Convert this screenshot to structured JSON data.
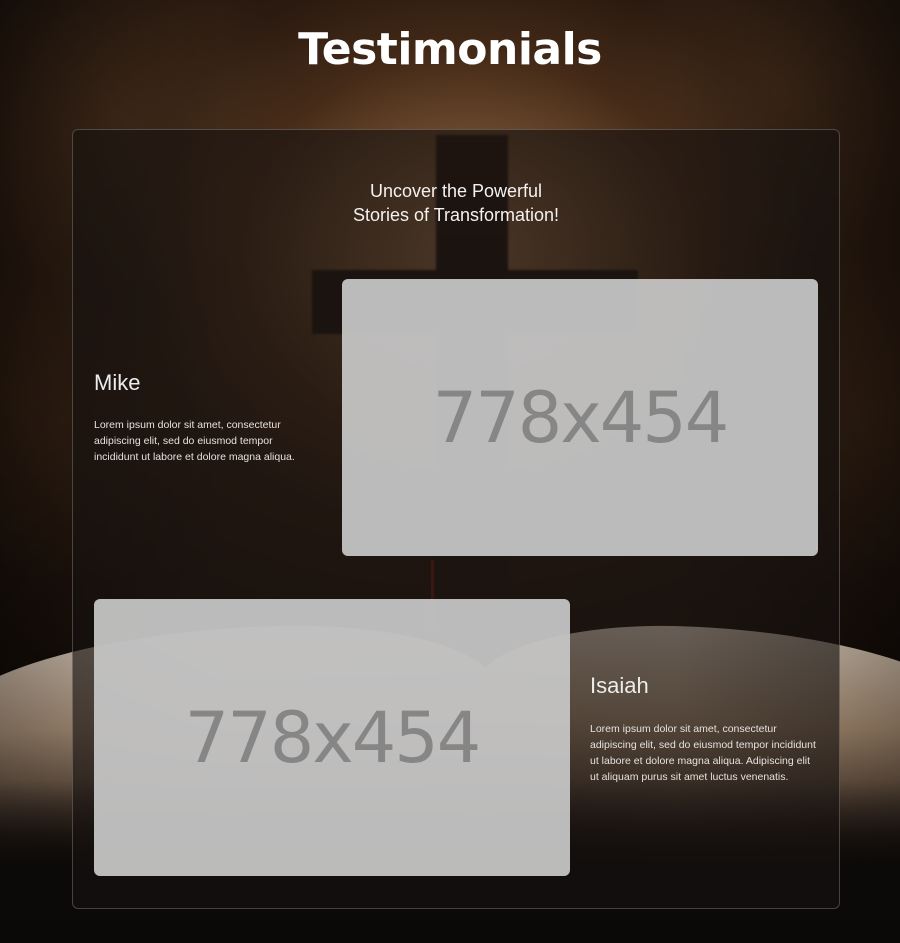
{
  "page": {
    "title": "Testimonials",
    "tagline_line1": "Uncover the Powerful",
    "tagline_line2": "Stories of Transformation!"
  },
  "testimonials": [
    {
      "name": "Mike",
      "text": "Lorem ipsum dolor sit amet, consectetur adipiscing elit, sed do eiusmod tempor incididunt ut labore et dolore magna aliqua.",
      "image_placeholder": "778x454"
    },
    {
      "name": "Isaiah",
      "text": "Lorem ipsum dolor sit amet, consectetur adipiscing elit, sed do eiusmod tempor incididunt ut labore et dolore magna aliqua. Adipiscing elit ut aliquam purus sit amet luctus venenatis.",
      "image_placeholder": "778x454"
    }
  ],
  "colors": {
    "title": "#ffffff",
    "placeholder_bg": "#c8c8c8",
    "placeholder_text": "#868686",
    "panel_border": "#ffffff38"
  }
}
